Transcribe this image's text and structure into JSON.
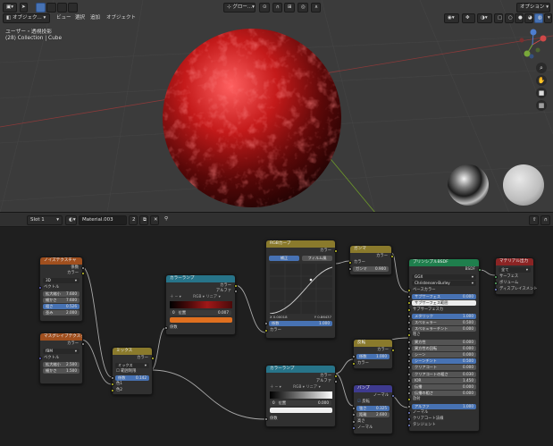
{
  "header": {
    "editor_icon": "cube-icon",
    "mode": "オブジェク...",
    "menus": [
      "ビュー",
      "選択",
      "追加",
      "オブジェクト"
    ],
    "transform": "グロー...",
    "options": "オプション"
  },
  "viewport": {
    "view_name": "ユーザー・透視投影",
    "collection": "(28) Collection | Cube",
    "gizmo": {
      "x": "X",
      "y": "Y",
      "z": "Z"
    }
  },
  "node_header": {
    "slot": "Slot 1",
    "material": "Material.003",
    "users": "2"
  },
  "nodes": {
    "noise": {
      "title": "ノイズテクスチャ",
      "outputs": [
        "係数",
        "カラー"
      ],
      "mode": "3D",
      "vector": "ベクトル",
      "fields": [
        [
          "拡大縮小",
          "7.600"
        ],
        [
          "細かさ",
          "7.600"
        ],
        [
          "粗さ",
          "0.526"
        ],
        [
          "歪み",
          "2.000"
        ]
      ]
    },
    "musgrave": {
      "title": "マスグレイブテクスチャ",
      "outputs": [
        "カラー"
      ],
      "mode": "fBM",
      "vector": "ベクトル",
      "fields": [
        [
          "拡大縮小",
          "2.500"
        ],
        [
          "細かさ",
          "1.500"
        ]
      ]
    },
    "mix": {
      "title": "ミックス",
      "output": "カラー",
      "mode": "ミックス",
      "clamp": "範囲制限",
      "fac": [
        "係数",
        "0.142"
      ],
      "inputs": [
        "色1",
        "色2"
      ]
    },
    "ramp1": {
      "title": "カラーランプ",
      "outputs": [
        "カラー",
        "アルファ"
      ],
      "color_mode": "RGB",
      "interp": "リニア",
      "pos": [
        "0",
        "位置",
        "0.007"
      ],
      "input": "係数"
    },
    "rgbcurve": {
      "title": "RGBカーブ",
      "output": "カラー",
      "tabs": [
        "補正",
        "フィルム風"
      ],
      "vals": [
        "X 0.00018",
        "Y 0.86437"
      ],
      "fac": [
        "係数",
        "1.000"
      ],
      "input": "カラー"
    },
    "gamma": {
      "title": "ガンマ",
      "output": "カラー",
      "input": "カラー",
      "field": [
        "ガンマ",
        "0.900"
      ]
    },
    "ramp2": {
      "title": "カラーランプ",
      "outputs": [
        "カラー",
        "アルファ"
      ],
      "color_mode": "RGB",
      "interp": "リニア",
      "pos": [
        "0",
        "位置",
        "0.000"
      ],
      "input": "係数"
    },
    "invert": {
      "title": "反転",
      "output": "カラー",
      "field": [
        "係数",
        "1.000"
      ],
      "input": "カラー"
    },
    "bump": {
      "title": "バンプ",
      "output": "ノーマル",
      "invert": "反転",
      "fields": [
        [
          "強さ",
          "0.325"
        ],
        [
          "距離",
          "2.600"
        ]
      ],
      "inputs": [
        "高さ",
        "ノーマル"
      ]
    },
    "principled": {
      "title": "プリンシプルBSDF",
      "output": "BSDF",
      "dist": "GGX",
      "sss": "Christensen-Burley",
      "rows": [
        [
          "ベースカラー",
          ""
        ],
        [
          "サブサーフェス",
          "0.000"
        ],
        [
          "サブサーフェス範囲",
          ""
        ],
        [
          "サブサーフェスカ",
          ""
        ],
        [
          "メタリック",
          "1.000"
        ],
        [
          "スペキュラー",
          "0.500"
        ],
        [
          "スペキュラーチント",
          "0.000"
        ],
        [
          "粗さ",
          ""
        ],
        [
          "異方性",
          "0.000"
        ],
        [
          "異方性の回転",
          "0.000"
        ],
        [
          "シーン",
          "0.000"
        ],
        [
          "シーンチント",
          "0.500"
        ],
        [
          "クリアコート",
          "0.000"
        ],
        [
          "クリアコートの粗さ",
          "0.030"
        ],
        [
          "IOR",
          "1.450"
        ],
        [
          "伝播",
          "0.000"
        ],
        [
          "伝播の粗さ",
          "0.000"
        ],
        [
          "放射",
          ""
        ],
        [
          "アルファ",
          "1.000"
        ],
        [
          "ノーマル",
          ""
        ],
        [
          "クリアコート法線",
          ""
        ],
        [
          "タンジェント",
          ""
        ]
      ]
    },
    "output": {
      "title": "マテリアル出力",
      "target": "全て",
      "inputs": [
        "サーフェス",
        "ボリューム",
        "ディスプレイスメント"
      ]
    }
  },
  "colors": {
    "accent": "#4772b3",
    "viewport_bg": "#3b3b3b",
    "node_bg": "#303030",
    "editor_bg": "#1f1f1f"
  }
}
